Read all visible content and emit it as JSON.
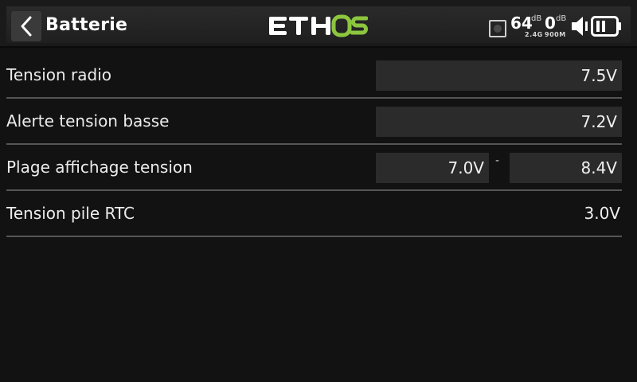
{
  "header": {
    "title": "Batterie",
    "logo_text": "ETHOS",
    "icons": {
      "back": "chevron-left-icon",
      "receiver": "receiver-status-icon",
      "volume": "speaker-icon",
      "battery": "battery-icon"
    },
    "signal1_value": "64",
    "signal1_unit": "dB",
    "signal1_band": "2.4G",
    "signal2_value": "0",
    "signal2_unit": "dB",
    "signal2_band": "900M"
  },
  "settings": [
    {
      "label": "Tension radio",
      "value": "7.5V"
    },
    {
      "label": "Alerte tension basse",
      "value": "7.2V"
    },
    {
      "label": "Plage affichage tension",
      "min": "7.0V",
      "separator": "-",
      "max": "8.4V"
    },
    {
      "label": "Tension pile RTC",
      "value": "3.0V"
    }
  ],
  "colors": {
    "logo_white": "#ffffff",
    "logo_green": "#8cc63f",
    "background": "#121212",
    "field": "#2b2b2b"
  }
}
